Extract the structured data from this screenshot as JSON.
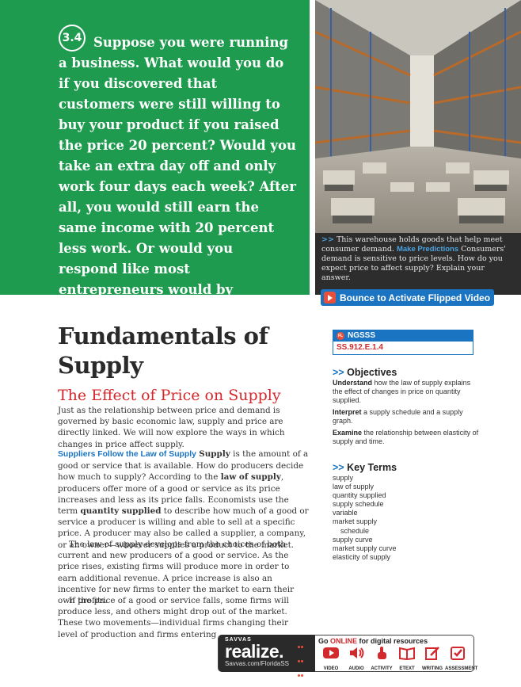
{
  "intro": {
    "badge": "3.4",
    "text": "Suppose you were running a business. What would you do if you discovered that customers were still willing to buy your product if you raised the price 20 percent? Would you take an extra day off and only work four days each week? After all, you would still earn the same income with 20 percent less work. Or would you respond like most entrepreneurs would by producing more and increasing your revenue?"
  },
  "photo": {
    "caption_arrows": ">>",
    "caption_lead": "This warehouse holds goods that help meet consumer demand.",
    "caption_highlight": "Make Predictions",
    "caption_tail": "Consumers' demand is sensitive to price levels. How do you expect price to affect supply? Explain your answer."
  },
  "flipped_video": {
    "label": "Bounce to Activate Flipped Video"
  },
  "lesson": {
    "title": "Fundamentals of Supply",
    "section_title": "The Effect of Price on Supply",
    "para1": "Just as the relationship between price and demand is governed by basic economic law, supply and price are directly linked. We will now explore the ways in which changes in price affect supply.",
    "para2_head": "Suppliers Follow the Law of Supply",
    "para2_term1": "Supply",
    "para2_a": "is the amount of a good or service that is available. How do producers decide how much to supply? According to the",
    "para2_term2": "law of supply",
    "para2_b": ", producers offer more of a good or service as its price increases and less as its price falls. Economists use the term",
    "para2_term3": "quantity supplied",
    "para2_c": "to describe how much of a good or service a producer is willing and able to sell at a specific price. A producer may also be called a supplier, a company, or an owner—whoever supplies a product to the market.",
    "para3": "The law of supply develops from the choices of both current and new producers of a good or service. As the price rises, existing firms will produce more in order to earn additional revenue. A price increase is also an incentive for new firms to enter the market to earn their own profits.",
    "para4": "If the price of a good or service falls, some firms will produce less, and others might drop out of the market. These two movements—individual firms changing their level of production and firms entering"
  },
  "sidebar": {
    "ngsss_badge": "FL",
    "ngsss_label": "NGSSS",
    "ngsss_code": "SS.912.E.1.4",
    "chevrons": ">>",
    "objectives_title": "Objectives",
    "objectives": [
      {
        "verb": "Understand",
        "rest": "how the law of supply explains the effect of changes in price on quantity supplied."
      },
      {
        "verb": "Interpret",
        "rest": "a supply schedule and a supply graph."
      },
      {
        "verb": "Examine",
        "rest": "the relationship between elasticity of supply and time."
      }
    ],
    "key_terms_title": "Key Terms",
    "key_terms": [
      "supply",
      "law of supply",
      "quantity supplied",
      "supply schedule",
      "variable",
      "market supply",
      "schedule",
      "supply curve",
      "market supply curve",
      "elasticity of supply"
    ]
  },
  "footer": {
    "brand_small": "SAVVAS",
    "brand": "realize.",
    "url": "Savvas.com/FloridaSS",
    "go_pre": "Go",
    "go_online": "ONLINE",
    "go_post": "for digital resources",
    "resources": [
      {
        "label": "VIDEO",
        "icon": "video-icon"
      },
      {
        "label": "AUDIO",
        "icon": "audio-icon"
      },
      {
        "label": "ACTIVITY",
        "icon": "activity-icon"
      },
      {
        "label": "ETEXT",
        "icon": "etext-icon"
      },
      {
        "label": "WRITING",
        "icon": "writing-icon"
      },
      {
        "label": "ASSESSMENT",
        "icon": "assessment-icon"
      }
    ],
    "accent": "#d2292d"
  },
  "colors": {
    "green": "#1e9b4e",
    "blue": "#1a74c1",
    "red": "#d2292d",
    "dark": "#2e2d2d"
  }
}
